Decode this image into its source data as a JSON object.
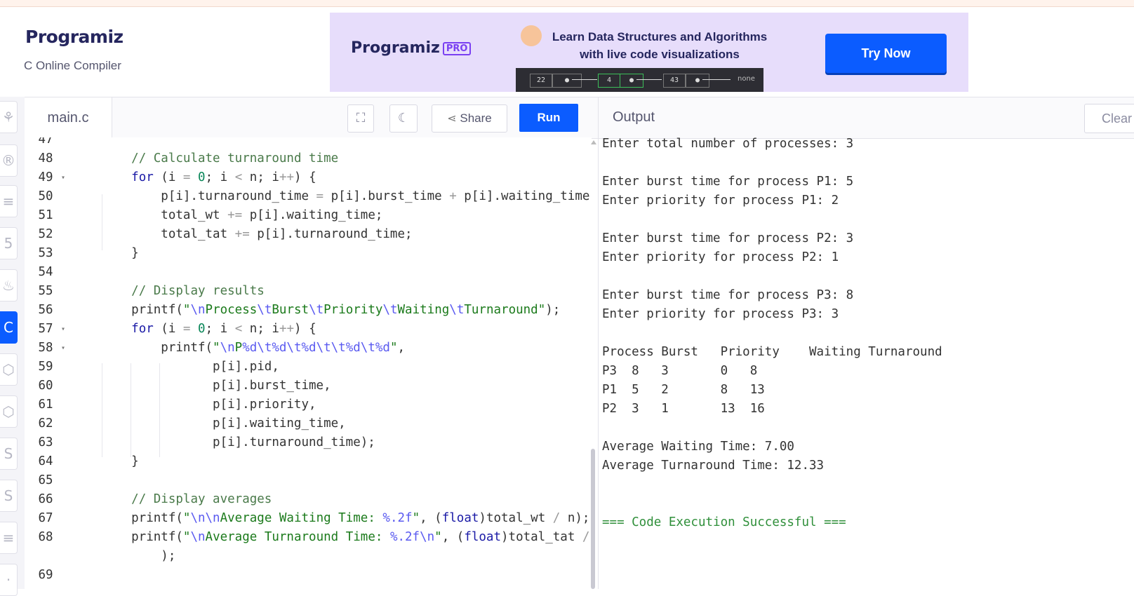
{
  "brand": {
    "name": "Programiz",
    "subtitle": "C Online Compiler"
  },
  "banner": {
    "logo": "Programiz",
    "pro_badge": "PRO",
    "headline_line1": "Learn Data Structures and Algorithms",
    "headline_line2": "with live code visualizations",
    "nodes": [
      "22",
      "4",
      "43"
    ],
    "tail": "none",
    "cta": "Try Now"
  },
  "toolbar": {
    "tab": "main.c",
    "share": "Share",
    "run": "Run"
  },
  "output_panel": {
    "title": "Output",
    "clear": "Clear"
  },
  "editor": {
    "line_numbers": [
      "47",
      "48",
      "49",
      "50",
      "51",
      "52",
      "53",
      "54",
      "55",
      "56",
      "57",
      "58",
      "59",
      "60",
      "61",
      "62",
      "63",
      "64",
      "65",
      "66",
      "67",
      "68",
      "",
      "69"
    ]
  },
  "output": {
    "lines": [
      "Enter total number of processes: 3",
      "",
      "Enter burst time for process P1: 5",
      "Enter priority for process P1: 2",
      "",
      "Enter burst time for process P2: 3",
      "Enter priority for process P2: 1",
      "",
      "Enter burst time for process P3: 8",
      "Enter priority for process P3: 3",
      "",
      "Process Burst   Priority    Waiting Turnaround",
      "P3  8   3       0   8",
      "P1  5   2       8   13",
      "P2  3   1       13  16",
      "",
      "Average Waiting Time: 7.00",
      "Average Turnaround Time: 12.33",
      "",
      "",
      "=== Code Execution Successful ==="
    ]
  }
}
